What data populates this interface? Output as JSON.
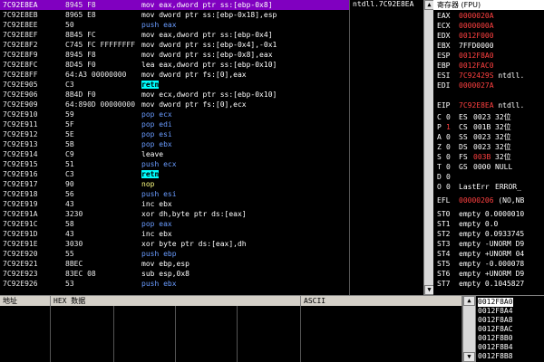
{
  "disasm": {
    "rows": [
      {
        "addr": "7C92E8EA",
        "hex": "8945 F8",
        "op": "mov",
        "args": "eax,dword ptr ss:[ebp-0x8]",
        "style": "sel"
      },
      {
        "addr": "7C92E8EB",
        "hex": "8965 E8",
        "op": "mov",
        "args": "dword ptr ss:[ebp-0x18],esp",
        "style": "white"
      },
      {
        "addr": "7C92E8EE",
        "hex": "50",
        "op": "push",
        "args": "eax",
        "style": "blue"
      },
      {
        "addr": "7C92E8EF",
        "hex": "8B45 FC",
        "op": "mov",
        "args": "eax,dword ptr ss:[ebp-0x4]",
        "style": "white"
      },
      {
        "addr": "7C92E8F2",
        "hex": "C745 FC FFFFFFFF",
        "op": "mov",
        "args": "dword ptr ss:[ebp-0x4],-0x1",
        "style": "white"
      },
      {
        "addr": "7C92E8F9",
        "hex": "8945 F8",
        "op": "mov",
        "args": "dword ptr ss:[ebp-0x8],eax",
        "style": "white"
      },
      {
        "addr": "7C92E8FC",
        "hex": "8D45 F0",
        "op": "lea",
        "args": "eax,dword ptr ss:[ebp-0x10]",
        "style": "white"
      },
      {
        "addr": "7C92E8FF",
        "hex": "64:A3 00000000",
        "op": "mov",
        "args": "dword ptr fs:[0],eax",
        "style": "white"
      },
      {
        "addr": "7C92E905",
        "hex": "C3",
        "op": "retn",
        "args": "",
        "style": "cyan"
      },
      {
        "addr": "7C92E906",
        "hex": "8B4D F0",
        "op": "mov",
        "args": "ecx,dword ptr ss:[ebp-0x10]",
        "style": "white"
      },
      {
        "addr": "7C92E909",
        "hex": "64:890D 00000000",
        "op": "mov",
        "args": "dword ptr fs:[0],ecx",
        "style": "white"
      },
      {
        "addr": "7C92E910",
        "hex": "59",
        "op": "pop",
        "args": "ecx",
        "style": "blue"
      },
      {
        "addr": "7C92E911",
        "hex": "5F",
        "op": "pop",
        "args": "edi",
        "style": "blue"
      },
      {
        "addr": "7C92E912",
        "hex": "5E",
        "op": "pop",
        "args": "esi",
        "style": "blue"
      },
      {
        "addr": "7C92E913",
        "hex": "5B",
        "op": "pop",
        "args": "ebx",
        "style": "blue"
      },
      {
        "addr": "7C92E914",
        "hex": "C9",
        "op": "leave",
        "args": "",
        "style": "white"
      },
      {
        "addr": "7C92E915",
        "hex": "51",
        "op": "push",
        "args": "ecx",
        "style": "blue"
      },
      {
        "addr": "7C92E916",
        "hex": "C3",
        "op": "retn",
        "args": "",
        "style": "cyan"
      },
      {
        "addr": "7C92E917",
        "hex": "90",
        "op": "nop",
        "args": "",
        "style": "yellow"
      },
      {
        "addr": "7C92E918",
        "hex": "56",
        "op": "push",
        "args": "esi",
        "style": "blue"
      },
      {
        "addr": "7C92E919",
        "hex": "43",
        "op": "inc",
        "args": "ebx",
        "style": "white"
      },
      {
        "addr": "7C92E91A",
        "hex": "3230",
        "op": "xor",
        "args": "dh,byte ptr ds:[eax]",
        "style": "white"
      },
      {
        "addr": "7C92E91C",
        "hex": "58",
        "op": "pop",
        "args": "eax",
        "style": "blue"
      },
      {
        "addr": "7C92E91D",
        "hex": "43",
        "op": "inc",
        "args": "ebx",
        "style": "white"
      },
      {
        "addr": "7C92E91E",
        "hex": "3030",
        "op": "xor",
        "args": "byte ptr ds:[eax],dh",
        "style": "white"
      },
      {
        "addr": "7C92E920",
        "hex": "55",
        "op": "push",
        "args": "ebp",
        "style": "blue"
      },
      {
        "addr": "7C92E921",
        "hex": "8BEC",
        "op": "mov",
        "args": "ebp,esp",
        "style": "white"
      },
      {
        "addr": "7C92E923",
        "hex": "83EC 08",
        "op": "sub",
        "args": "esp,0x8",
        "style": "white"
      },
      {
        "addr": "7C92E926",
        "hex": "53",
        "op": "push",
        "args": "ebx",
        "style": "blue"
      }
    ]
  },
  "comment": {
    "text": "ntdll.7C92E8EA"
  },
  "registers": {
    "title": "寄存器 (FPU)",
    "gp": [
      {
        "name": "EAX",
        "value": "0000020A",
        "color": "red"
      },
      {
        "name": "ECX",
        "value": "0000000A",
        "color": "red"
      },
      {
        "name": "EDX",
        "value": "0012F000",
        "color": "red"
      },
      {
        "name": "EBX",
        "value": "7FFD0000",
        "color": "white"
      },
      {
        "name": "ESP",
        "value": "0012F8A0",
        "color": "red"
      },
      {
        "name": "EBP",
        "value": "0012FAC0",
        "color": "red"
      },
      {
        "name": "ESI",
        "value": "7C92429S",
        "extra": "ntdll.",
        "color": "red"
      },
      {
        "name": "EDI",
        "value": "0000027A",
        "color": "red"
      },
      {
        "name": "EIP",
        "value": "7C92E8EA",
        "extra": "ntdll.",
        "color": "red"
      }
    ],
    "flags": [
      {
        "f": "C",
        "v": "0",
        "seg": "ES",
        "sv": "0023",
        "tail": "32位"
      },
      {
        "f": "P",
        "v": "1",
        "seg": "CS",
        "sv": "001B",
        "tail": "32位",
        "vred": true
      },
      {
        "f": "A",
        "v": "0",
        "seg": "SS",
        "sv": "0023",
        "tail": "32位"
      },
      {
        "f": "Z",
        "v": "0",
        "seg": "DS",
        "sv": "0023",
        "tail": "32位"
      },
      {
        "f": "S",
        "v": "0",
        "seg": "FS",
        "sv": "003B",
        "tail": "32位",
        "svred": true
      },
      {
        "f": "T",
        "v": "0",
        "seg": "GS",
        "sv": "0000",
        "tail": "NULL"
      },
      {
        "f": "D",
        "v": "0",
        "seg": "",
        "sv": "",
        "tail": ""
      },
      {
        "f": "O",
        "v": "0",
        "seg": "LastErr",
        "sv": "ERROR_",
        "tail": ""
      }
    ],
    "efl": {
      "name": "EFL",
      "value": "00000206",
      "extra": "(NO,NB"
    },
    "st": [
      {
        "name": "ST0",
        "value": "empty 0.0000010"
      },
      {
        "name": "ST1",
        "value": "empty 0.0"
      },
      {
        "name": "ST2",
        "value": "empty 0.0933745"
      },
      {
        "name": "ST3",
        "value": "empty -UNORM D9"
      },
      {
        "name": "ST4",
        "value": "empty +UNORM 04"
      },
      {
        "name": "ST5",
        "value": "empty -0.000078"
      },
      {
        "name": "ST6",
        "value": "empty +UNORM D9"
      },
      {
        "name": "ST7",
        "value": "empty 0.1045827"
      }
    ]
  },
  "dump": {
    "headers": {
      "addr": "地址",
      "hex": "HEX 数据",
      "ascii": "ASCII"
    }
  },
  "stack": {
    "rows": [
      "0012F8A0",
      "0012F8A4",
      "0012F8A8",
      "0012F8AC",
      "0012F8B0",
      "0012F8B4",
      "0012F8B8"
    ]
  }
}
